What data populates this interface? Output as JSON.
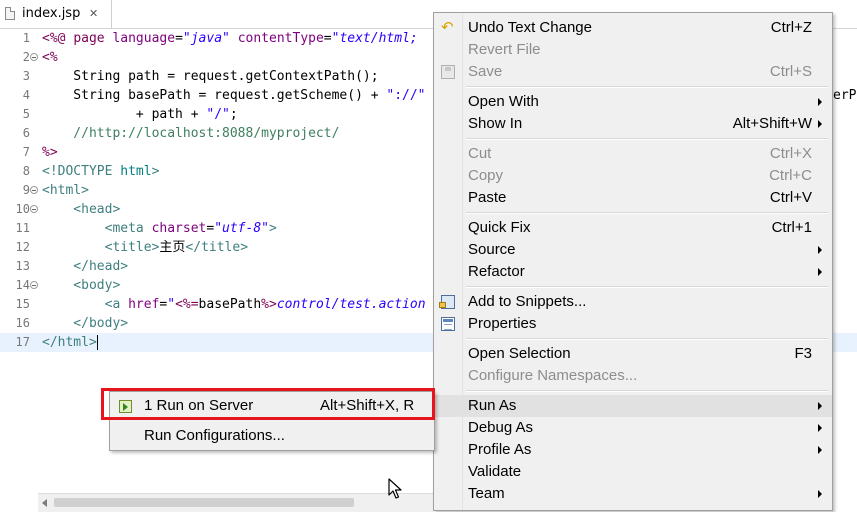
{
  "editor": {
    "tab_title": "index.jsp",
    "tab_close": "✕",
    "lines": [
      {
        "n": "1",
        "fold": false,
        "spans": [
          [
            "k-jsp",
            "<%@ "
          ],
          [
            "k-jsp",
            "page "
          ],
          [
            "k-attr",
            "language"
          ],
          [
            "k-plain",
            "="
          ],
          [
            "k-str",
            "\"java\""
          ],
          [
            "k-plain",
            " "
          ],
          [
            "k-attr",
            "contentType"
          ],
          [
            "k-plain",
            "="
          ],
          [
            "k-str",
            "\"text/html;"
          ]
        ]
      },
      {
        "n": "2",
        "fold": true,
        "spans": [
          [
            "k-jsp",
            "<%"
          ]
        ]
      },
      {
        "n": "3",
        "fold": false,
        "spans": [
          [
            "k-plain",
            "    String path = request.getContextPath();"
          ]
        ]
      },
      {
        "n": "4",
        "fold": false,
        "spans": [
          [
            "k-plain",
            "    String basePath = request.getScheme() + "
          ],
          [
            "k-jstr",
            "\"://\""
          ]
        ]
      },
      {
        "n": "5",
        "fold": false,
        "spans": [
          [
            "k-plain",
            "            + path + "
          ],
          [
            "k-jstr",
            "\"/\""
          ],
          [
            "k-plain",
            ";"
          ]
        ]
      },
      {
        "n": "6",
        "fold": false,
        "spans": [
          [
            "k-com",
            "    //http://localhost:8088/myproject/"
          ]
        ]
      },
      {
        "n": "7",
        "fold": false,
        "spans": [
          [
            "k-jsp",
            "%>"
          ]
        ]
      },
      {
        "n": "8",
        "fold": false,
        "spans": [
          [
            "k-tag",
            "<!DOCTYPE "
          ],
          [
            "k-dtd",
            "html"
          ],
          [
            "k-tag",
            ">"
          ]
        ]
      },
      {
        "n": "9",
        "fold": true,
        "spans": [
          [
            "k-tag",
            "<html>"
          ]
        ]
      },
      {
        "n": "10",
        "fold": true,
        "spans": [
          [
            "k-tag",
            "    <head>"
          ]
        ]
      },
      {
        "n": "11",
        "fold": false,
        "spans": [
          [
            "k-tag",
            "        <meta "
          ],
          [
            "k-attr",
            "charset"
          ],
          [
            "k-plain",
            "="
          ],
          [
            "k-str",
            "\"utf-8\""
          ],
          [
            "k-tag",
            ">"
          ]
        ]
      },
      {
        "n": "12",
        "fold": false,
        "spans": [
          [
            "k-tag",
            "        <title>"
          ],
          [
            "k-plain",
            "主页"
          ],
          [
            "k-tag",
            "</title>"
          ]
        ]
      },
      {
        "n": "13",
        "fold": false,
        "spans": [
          [
            "k-tag",
            "    </head>"
          ]
        ]
      },
      {
        "n": "14",
        "fold": true,
        "spans": [
          [
            "k-tag",
            "    <body>"
          ]
        ]
      },
      {
        "n": "15",
        "fold": false,
        "spans": [
          [
            "k-tag",
            "        <a "
          ],
          [
            "k-attr",
            "href"
          ],
          [
            "k-plain",
            "="
          ],
          [
            "k-str",
            "\""
          ],
          [
            "k-jsp",
            "<%="
          ],
          [
            "k-plain",
            "basePath"
          ],
          [
            "k-jsp",
            "%>"
          ],
          [
            "k-str",
            "control/test.action"
          ]
        ]
      },
      {
        "n": "16",
        "fold": false,
        "spans": [
          [
            "k-tag",
            "    </body>"
          ]
        ]
      },
      {
        "n": "17",
        "fold": false,
        "current": true,
        "spans": [
          [
            "k-tag",
            "</html>"
          ]
        ]
      }
    ],
    "overflow_text": "erP"
  },
  "context_menu": {
    "items": [
      {
        "type": "item",
        "label": "Undo Text Change",
        "shortcut": "Ctrl+Z",
        "icon": "undo-icon",
        "enabled": true
      },
      {
        "type": "item",
        "label": "Revert File",
        "shortcut": "",
        "enabled": false
      },
      {
        "type": "item",
        "label": "Save",
        "shortcut": "Ctrl+S",
        "icon": "save-icon",
        "enabled": false
      },
      {
        "type": "sep"
      },
      {
        "type": "item",
        "label": "Open With",
        "shortcut": "",
        "submenu": true,
        "enabled": true
      },
      {
        "type": "item",
        "label": "Show In",
        "shortcut": "Alt+Shift+W",
        "submenu": true,
        "enabled": true
      },
      {
        "type": "sep"
      },
      {
        "type": "item",
        "label": "Cut",
        "shortcut": "Ctrl+X",
        "enabled": false
      },
      {
        "type": "item",
        "label": "Copy",
        "shortcut": "Ctrl+C",
        "enabled": false
      },
      {
        "type": "item",
        "label": "Paste",
        "shortcut": "Ctrl+V",
        "enabled": true
      },
      {
        "type": "sep"
      },
      {
        "type": "item",
        "label": "Quick Fix",
        "shortcut": "Ctrl+1",
        "enabled": true
      },
      {
        "type": "item",
        "label": "Source",
        "shortcut": "",
        "submenu": true,
        "enabled": true
      },
      {
        "type": "item",
        "label": "Refactor",
        "shortcut": "",
        "submenu": true,
        "enabled": true
      },
      {
        "type": "sep"
      },
      {
        "type": "item",
        "label": "Add to Snippets...",
        "shortcut": "",
        "icon": "snippets-icon",
        "enabled": true
      },
      {
        "type": "item",
        "label": "Properties",
        "shortcut": "",
        "icon": "properties-icon",
        "enabled": true
      },
      {
        "type": "sep"
      },
      {
        "type": "item",
        "label": "Open Selection",
        "shortcut": "F3",
        "enabled": true
      },
      {
        "type": "item",
        "label": "Configure Namespaces...",
        "shortcut": "",
        "enabled": false
      },
      {
        "type": "sep"
      },
      {
        "type": "item",
        "label": "Run As",
        "shortcut": "",
        "submenu": true,
        "enabled": true,
        "highlighted": true
      },
      {
        "type": "item",
        "label": "Debug As",
        "shortcut": "",
        "submenu": true,
        "enabled": true
      },
      {
        "type": "item",
        "label": "Profile As",
        "shortcut": "",
        "submenu": true,
        "enabled": true
      },
      {
        "type": "item",
        "label": "Validate",
        "shortcut": "",
        "enabled": true
      },
      {
        "type": "item",
        "label": "Team",
        "shortcut": "",
        "submenu": true,
        "enabled": true
      }
    ]
  },
  "run_as_submenu": {
    "items": [
      {
        "label": "1 Run on Server",
        "shortcut": "Alt+Shift+X, R",
        "icon": "run-on-server-icon"
      },
      {
        "label": "Run Configurations...",
        "shortcut": ""
      }
    ]
  },
  "colors": {
    "highlight_border": "#e8141b",
    "menu_bg": "#f0f0f0",
    "disabled_text": "#8d8d8d",
    "current_line": "#e8f2fe"
  }
}
